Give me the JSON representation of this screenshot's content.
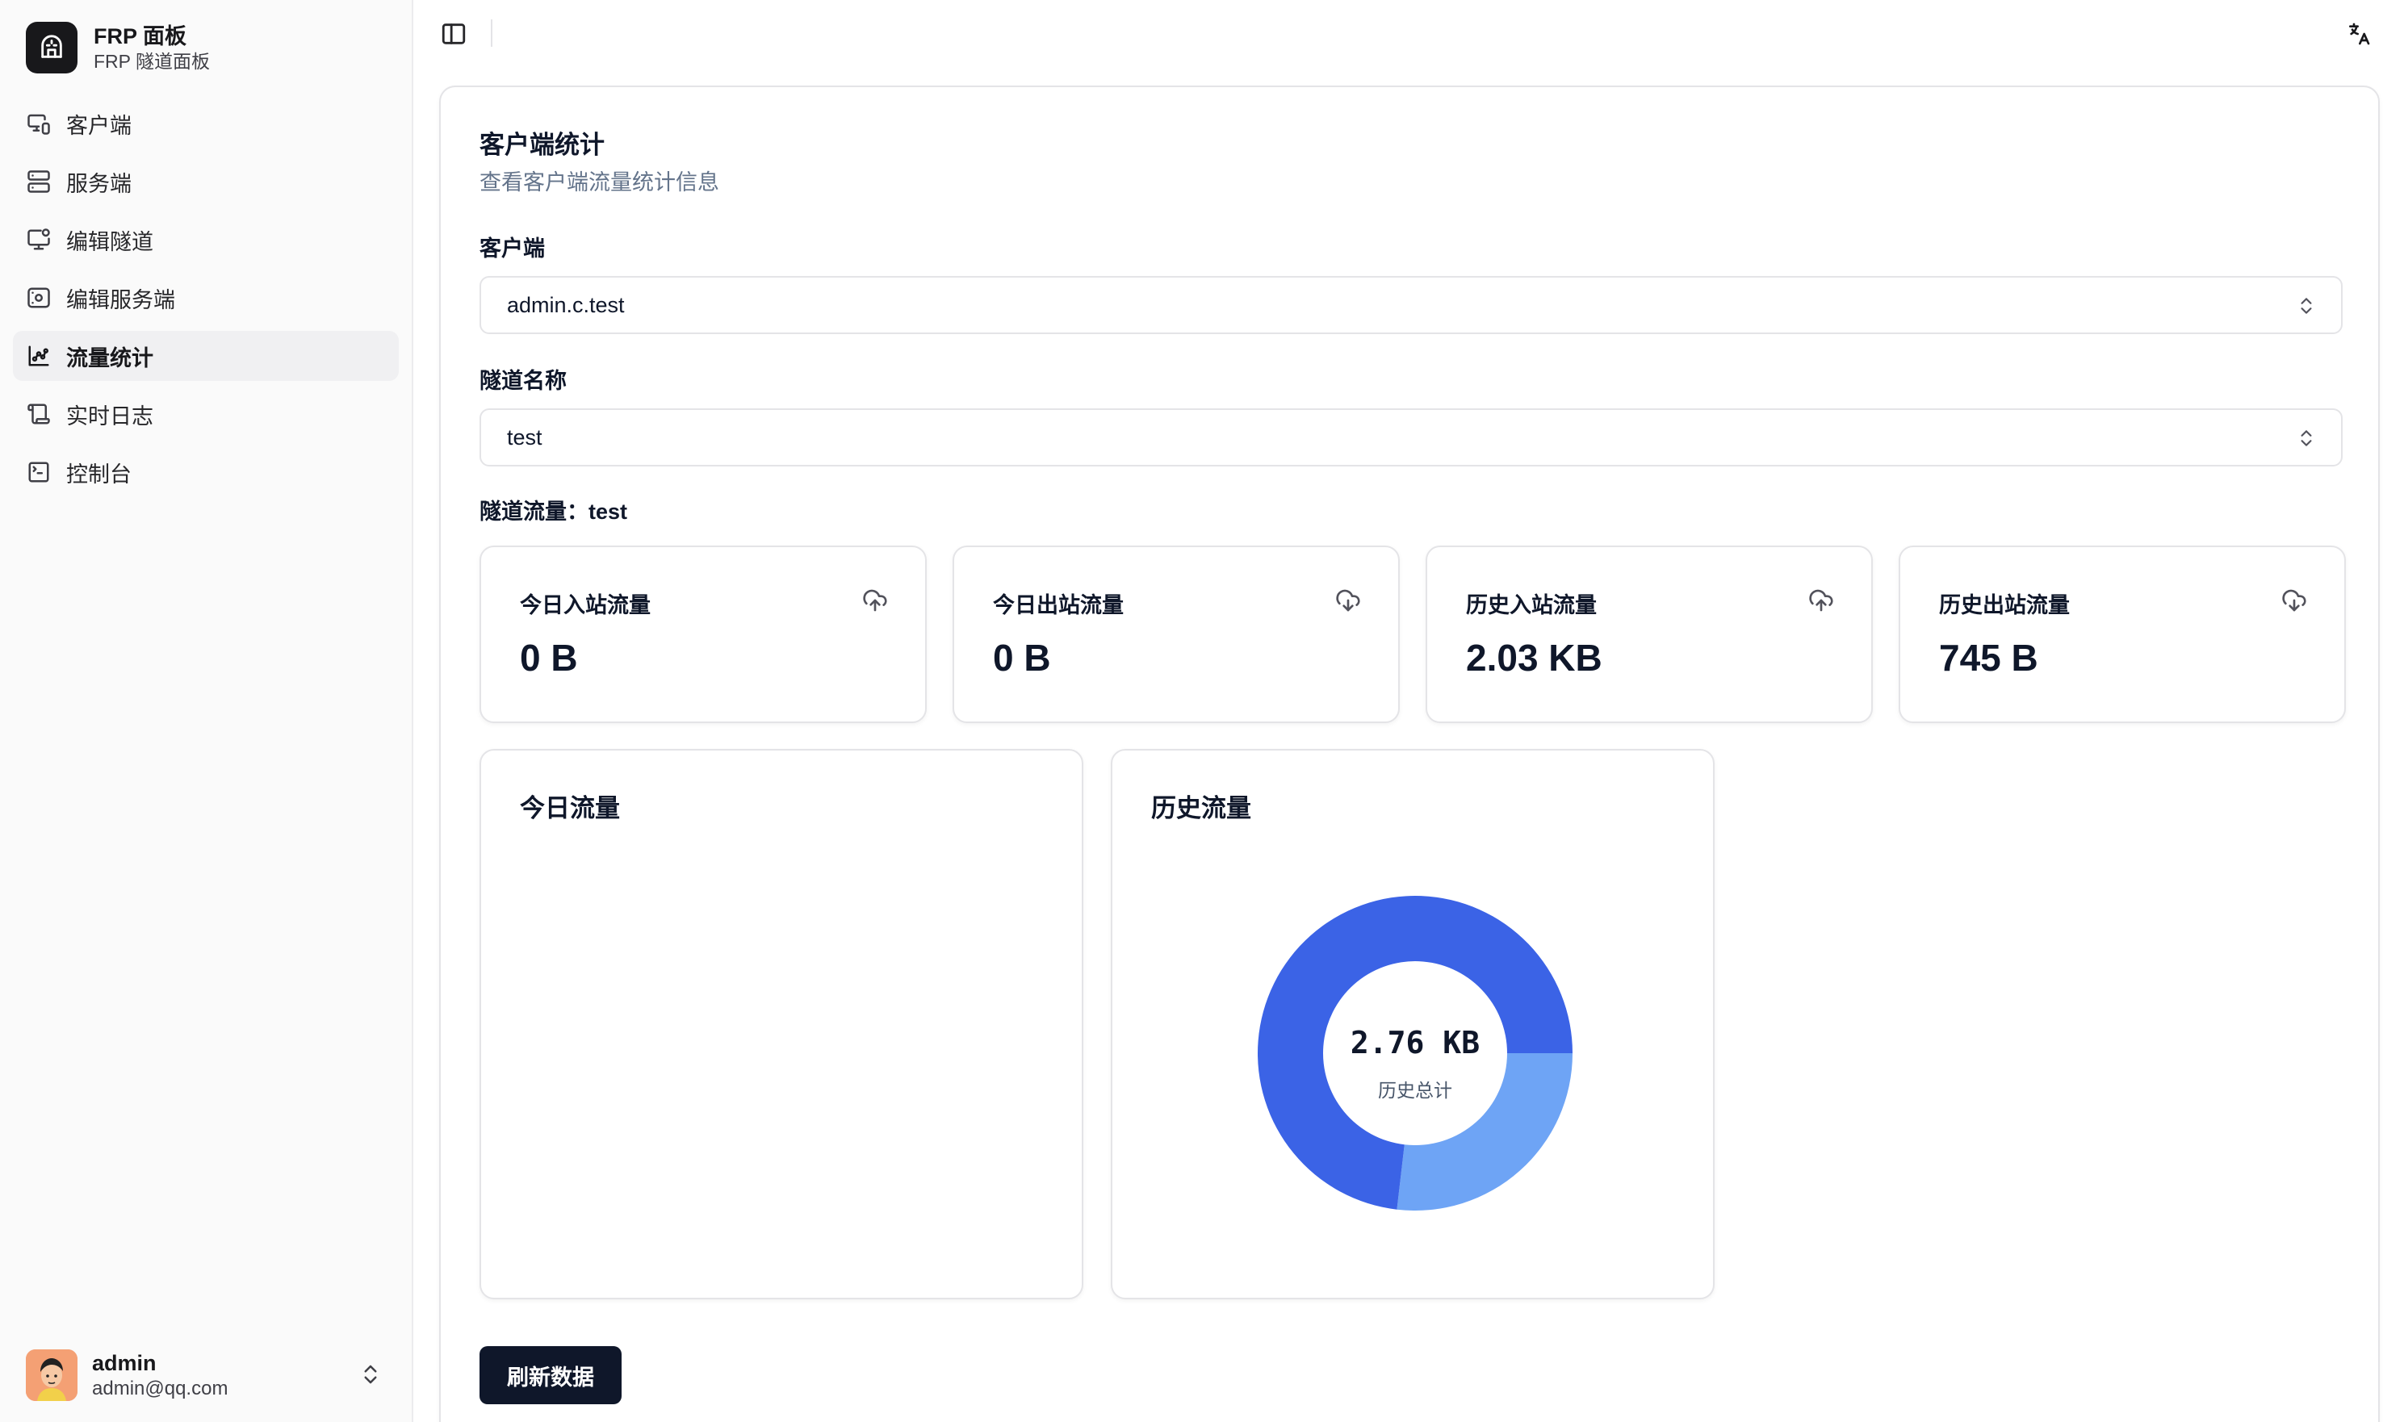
{
  "brand": {
    "title": "FRP 面板",
    "subtitle": "FRP 隧道面板"
  },
  "sidebar": {
    "items": [
      {
        "label": "客户端",
        "icon": "monitor-smartphone-icon"
      },
      {
        "label": "服务端",
        "icon": "server-icon"
      },
      {
        "label": "编辑隧道",
        "icon": "monitor-cog-icon"
      },
      {
        "label": "编辑服务端",
        "icon": "server-cog-icon"
      },
      {
        "label": "流量统计",
        "icon": "chart-icon",
        "active": true
      },
      {
        "label": "实时日志",
        "icon": "scroll-icon"
      },
      {
        "label": "控制台",
        "icon": "terminal-icon"
      }
    ]
  },
  "user": {
    "name": "admin",
    "email": "admin@qq.com"
  },
  "page": {
    "title": "客户端统计",
    "description": "查看客户端流量统计信息",
    "client_label": "客户端",
    "client_value": "admin.c.test",
    "tunnel_label": "隧道名称",
    "tunnel_value": "test",
    "tunnel_traffic": "隧道流量：test"
  },
  "stats": [
    {
      "label": "今日入站流量",
      "value": "0 B",
      "icon": "cloud-upload-icon"
    },
    {
      "label": "今日出站流量",
      "value": "0 B",
      "icon": "cloud-download-icon"
    },
    {
      "label": "历史入站流量",
      "value": "2.03 KB",
      "icon": "cloud-upload-icon"
    },
    {
      "label": "历史出站流量",
      "value": "745 B",
      "icon": "cloud-download-icon"
    }
  ],
  "charts": {
    "today_title": "今日流量",
    "history_title": "历史流量",
    "history_total": "2.76  KB",
    "history_caption": "历史总计"
  },
  "chart_data": {
    "type": "pie",
    "title": "历史流量",
    "categories": [
      "历史入站流量",
      "历史出站流量"
    ],
    "values": [
      2.03,
      0.745
    ],
    "unit": "KB",
    "colors": [
      "#3b63e6",
      "#6ea4f5"
    ]
  },
  "refresh_label": "刷新数据"
}
